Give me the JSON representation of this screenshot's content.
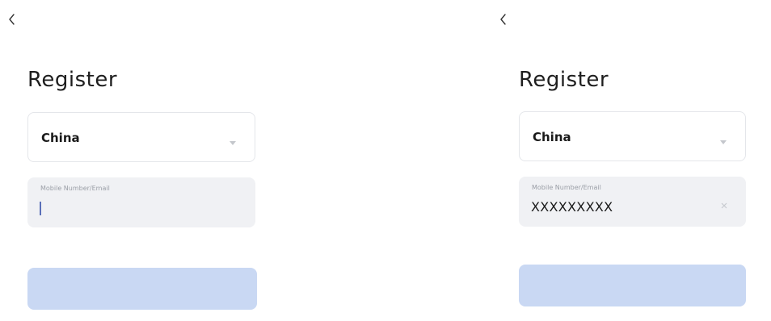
{
  "left_screen": {
    "title": "Register",
    "country": {
      "value": "China"
    },
    "mobile_field": {
      "label": "Mobile Number/Email",
      "value": ""
    },
    "submit_button": {
      "label": ""
    }
  },
  "right_screen": {
    "title": "Register",
    "country": {
      "value": "China"
    },
    "mobile_field": {
      "label": "Mobile Number/Email",
      "value": "XXXXXXXXX"
    },
    "submit_button": {
      "label": ""
    }
  },
  "colors": {
    "accent": "#5a6fb8",
    "button_disabled": "#c9d8f3",
    "field_bg": "#f0f1f4"
  },
  "icons": [
    "back-icon",
    "chevron-down-icon",
    "clear-icon"
  ]
}
